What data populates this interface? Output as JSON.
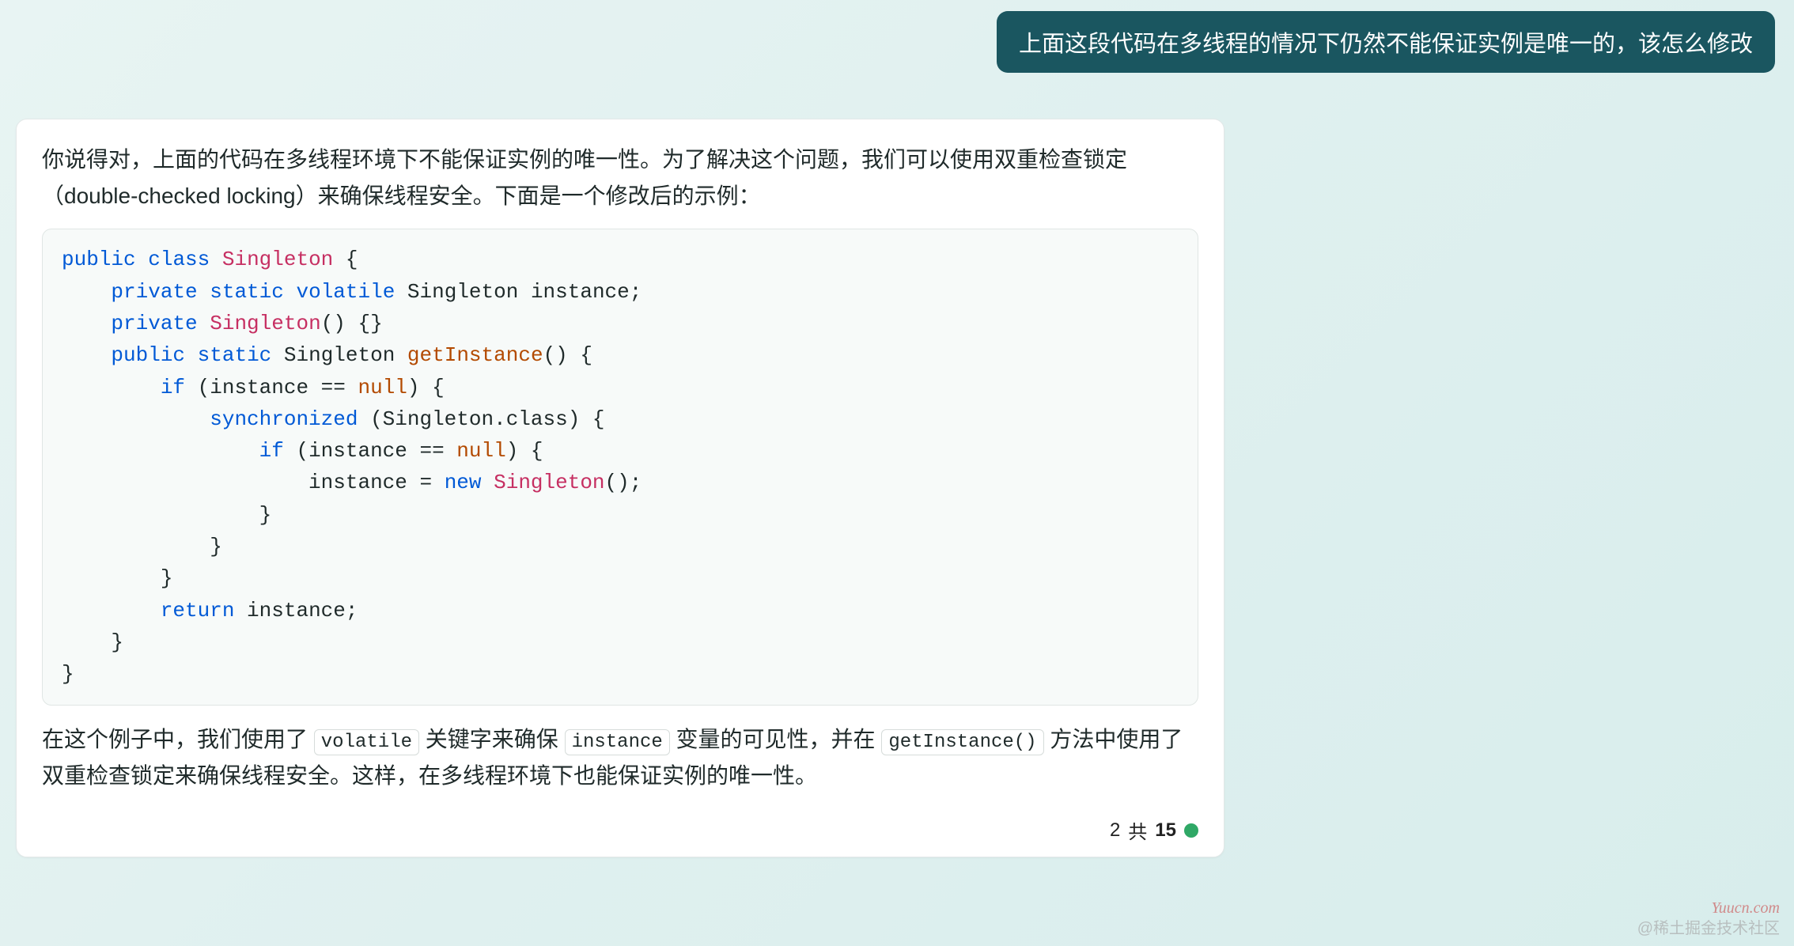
{
  "user_message": "上面这段代码在多线程的情况下仍然不能保证实例是唯一的，该怎么修改",
  "assistant": {
    "intro_a": "你说得对，上面的代码在多线程环境下不能保证实例的唯一性。为了解决这个问题，我们可以使用双重检查锁定（double-checked locking）来确保线程安全。下面是一个修改后的示例：",
    "explain_1": "在这个例子中，我们使用了 ",
    "code_inline_1": "volatile",
    "explain_2": " 关键字来确保 ",
    "code_inline_2": "instance",
    "explain_3": " 变量的可见性，并在 ",
    "code_inline_3": "getInstance()",
    "explain_4": " 方法中使用了双重检查锁定来确保线程安全。这样，在多线程环境下也能保证实例的唯一性。"
  },
  "code": {
    "tokens": {
      "public": "public",
      "class": "class",
      "private": "private",
      "static": "static",
      "volatile": "volatile",
      "if": "if",
      "synchronized": "synchronized",
      "return": "return",
      "new": "new",
      "null": "null",
      "Singleton": "Singleton",
      "getInstance": "getInstance",
      "instance": "instance"
    }
  },
  "footer": {
    "current": "2",
    "of_label": " 共 ",
    "total": "15"
  },
  "watermarks": {
    "w1": "Yuucn.com",
    "w2": "@稀土掘金技术社区"
  }
}
